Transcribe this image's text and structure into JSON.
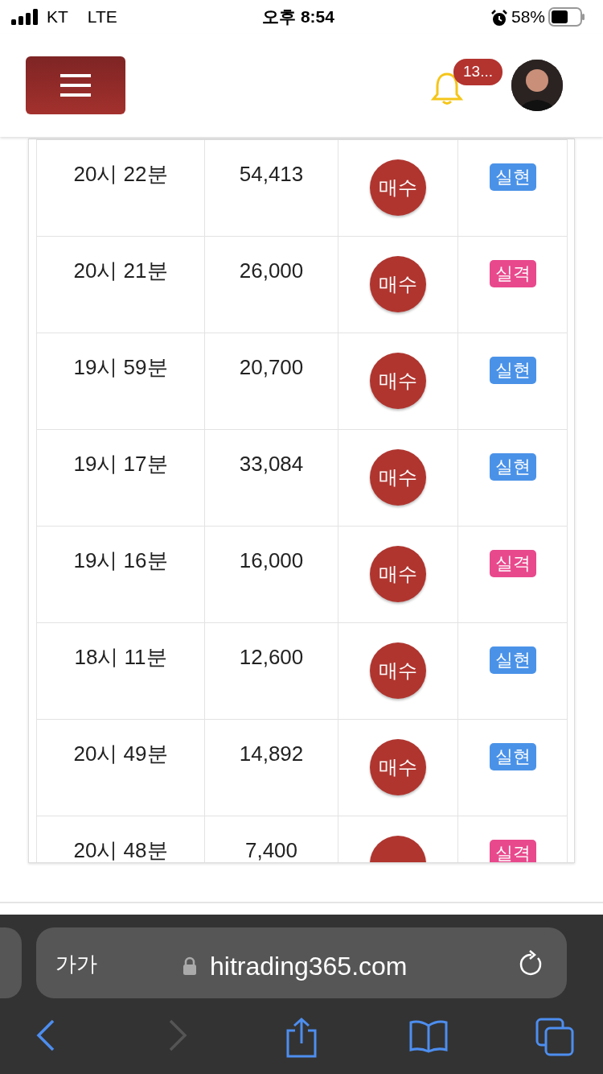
{
  "status_bar": {
    "carrier": "KT",
    "network": "LTE",
    "time": "오후 8:54",
    "battery": "58%",
    "alarm": true
  },
  "header": {
    "notification_count": "13..."
  },
  "trades": [
    {
      "time": "20시 22분",
      "amount": "54,413",
      "action": "매수",
      "result": "실현",
      "color": "#4a92e8"
    },
    {
      "time": "20시 21분",
      "amount": "26,000",
      "action": "매수",
      "result": "실격",
      "color": "#e8498c"
    },
    {
      "time": "19시 59분",
      "amount": "20,700",
      "action": "매수",
      "result": "실현",
      "color": "#4a92e8"
    },
    {
      "time": "19시 17분",
      "amount": "33,084",
      "action": "매수",
      "result": "실현",
      "color": "#4a92e8"
    },
    {
      "time": "19시 16분",
      "amount": "16,000",
      "action": "매수",
      "result": "실격",
      "color": "#e8498c"
    },
    {
      "time": "18시 11분",
      "amount": "12,600",
      "action": "매수",
      "result": "실현",
      "color": "#4a92e8"
    },
    {
      "time": "20시 49분",
      "amount": "14,892",
      "action": "매수",
      "result": "실현",
      "color": "#4a92e8"
    },
    {
      "time": "20시 48분",
      "amount": "7,400",
      "result": "실격",
      "color": "#e8498c"
    }
  ],
  "browser": {
    "text_size": "가가",
    "url": "hitrading365.com"
  }
}
